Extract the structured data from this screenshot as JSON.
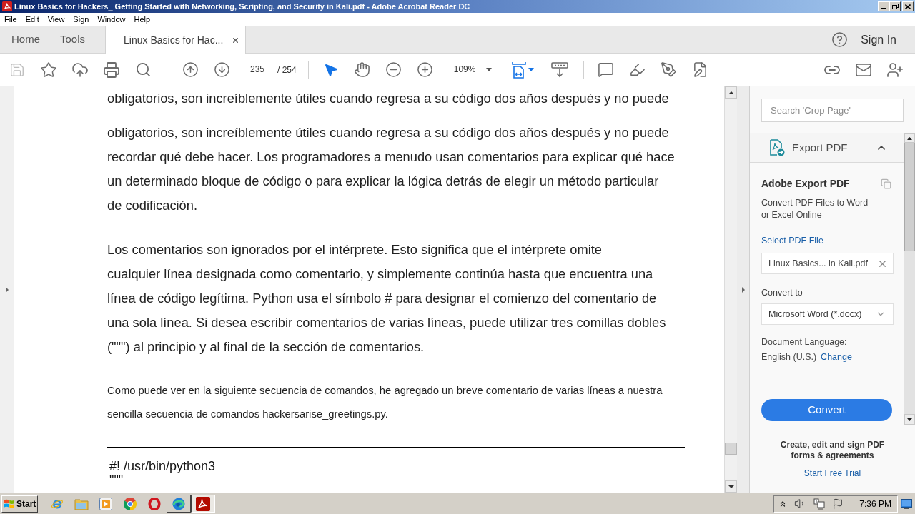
{
  "window": {
    "title": "Linux Basics for Hackers_ Getting Started with Networking, Scripting, and Security in Kali.pdf - Adobe Acrobat Reader DC"
  },
  "menu": [
    "File",
    "Edit",
    "View",
    "Sign",
    "Window",
    "Help"
  ],
  "tabs": [
    {
      "label": "Home",
      "selected": false,
      "closable": false
    },
    {
      "label": "Tools",
      "selected": false,
      "closable": false
    },
    {
      "label": "Linux Basics for Hac...",
      "selected": true,
      "closable": true
    }
  ],
  "account": {
    "sign_in": "Sign In"
  },
  "toolbar": {
    "save_disabled": true,
    "page_current": "235",
    "page_total": "/ 254",
    "tools": [
      {
        "kind": "select",
        "selected": true
      },
      {
        "kind": "hand",
        "selected": false
      }
    ],
    "zoom": "109%"
  },
  "document": {
    "blocks": [
      {
        "kind": "partial",
        "lines": [
          "obligatorios, son increíblemente útiles cuando regresa a su código dos años después y no puede"
        ]
      },
      {
        "kind": "body",
        "lines": [
          "obligatorios, son increíblemente útiles cuando regresa a su código dos años después y no puede",
          "recordar qué debe hacer. Los programadores a menudo usan comentarios para explicar qué hace",
          "un determinado bloque de código o para explicar la lógica detrás de elegir un método particular",
          "de codificación."
        ]
      },
      {
        "kind": "body",
        "lines": [
          "Los comentarios son ignorados por el intérprete. Esto significa que el intérprete omite",
          "cualquier línea designada como comentario, y simplemente continúa hasta que encuentra una",
          "línea de código legítima. Python usa el símbolo # para designar el comienzo del comentario de",
          "una sola línea. Si desea escribir comentarios de varias líneas, puede utilizar tres comillas dobles",
          "(\"\"\") al principio y al final de la sección de comentarios."
        ]
      },
      {
        "kind": "small",
        "lines": [
          "Como puede ver en la siguiente secuencia de comandos, he agregado un breve comentario de varias líneas a nuestra",
          "sencilla secuencia de comandos hackersarise_greetings.py."
        ]
      },
      {
        "kind": "rule"
      },
      {
        "kind": "code",
        "lines": [
          "#! /usr/bin/python3",
          "\"\"\""
        ]
      }
    ]
  },
  "tools_panel": {
    "search": {
      "placeholder": "Search 'Crop Page'"
    },
    "export": {
      "title": "Export PDF",
      "expanded": true,
      "heading": "Adobe Export PDF",
      "description": [
        "Convert PDF Files to Word",
        "or Excel Online"
      ],
      "select_link": "Select PDF File",
      "file": "Linux Basics... in Kali.pdf",
      "convert_to_label": "Convert to",
      "format": "Microsoft Word (*.docx)",
      "language_label": "Document Language:",
      "language": "English (U.S.)",
      "change_link": "Change",
      "convert_button": "Convert"
    },
    "promo": {
      "lines": [
        "Create, edit and sign PDF",
        "forms & agreements"
      ],
      "link": "Start Free Trial"
    }
  },
  "taskbar": {
    "start": "Start",
    "apps": [
      {
        "kind": "ie",
        "open": false,
        "selected": false
      },
      {
        "kind": "folder",
        "open": false,
        "selected": false
      },
      {
        "kind": "media",
        "open": false,
        "selected": false
      },
      {
        "kind": "chrome",
        "open": false,
        "selected": false
      },
      {
        "kind": "opera",
        "open": false,
        "selected": false
      },
      {
        "kind": "edge",
        "open": true,
        "selected": false
      },
      {
        "kind": "acrobat",
        "open": true,
        "selected": true
      }
    ],
    "clock": "7:36 PM"
  }
}
